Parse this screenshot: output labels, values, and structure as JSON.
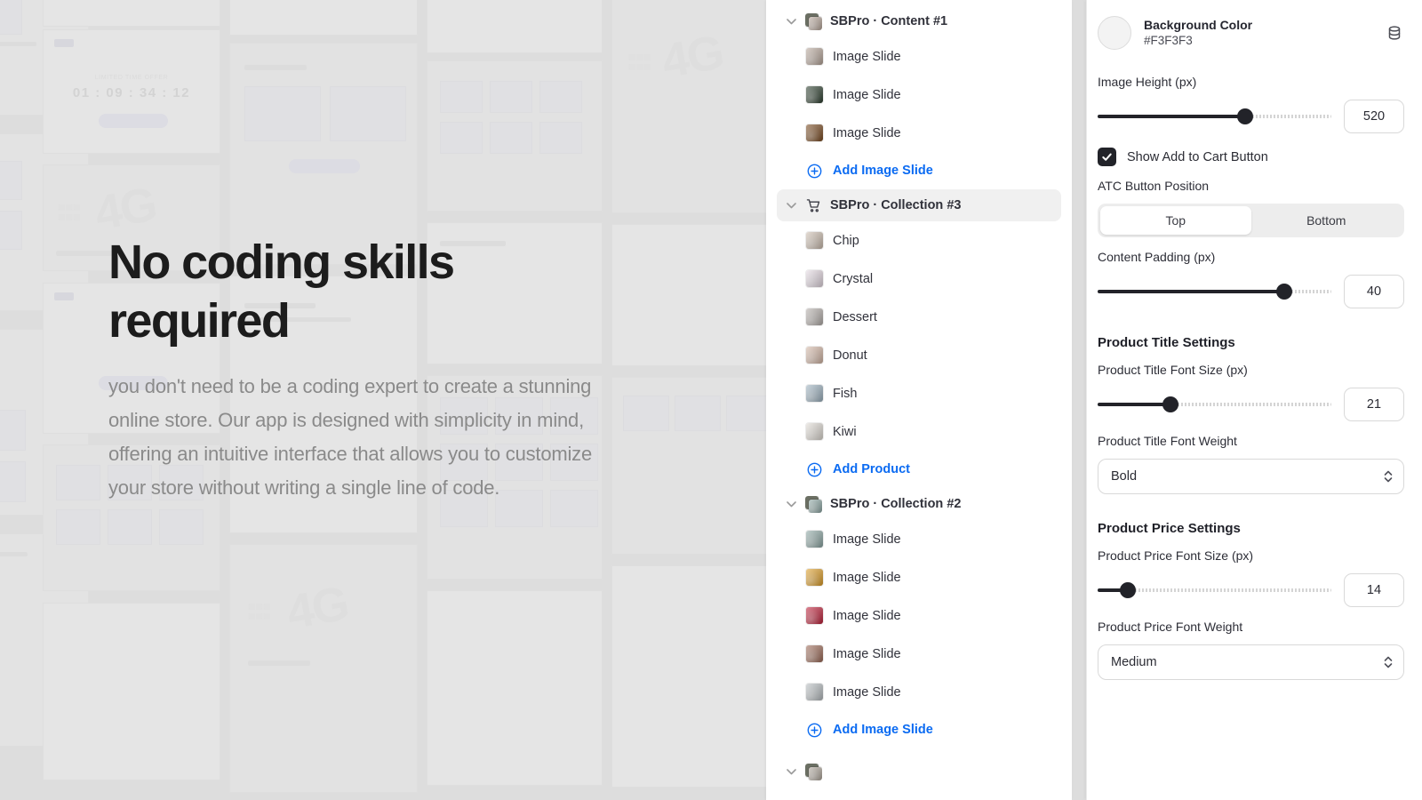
{
  "hero": {
    "title": "No coding skills\nrequired",
    "body": "you don't need to be a coding expert to create a stunning online store. Our app is designed with simplicity in mind, offering an intuitive interface that allows you to customize your store without writing a single line of code."
  },
  "background": {
    "timer_value": "01 : 09 : 34 : 12",
    "timer_label": "LIMITED TIME OFFER",
    "logo_text": "4G"
  },
  "tree": {
    "groups": [
      {
        "label": "SBPro · Content #1",
        "icon": "photo-stack-icon",
        "selected": false,
        "children": [
          {
            "label": "Image Slide",
            "thumb": "#b9a89c"
          },
          {
            "label": "Image Slide",
            "thumb": "#2e4030"
          },
          {
            "label": "Image Slide",
            "thumb": "#7a4a20"
          }
        ],
        "add_label": "Add Image Slide"
      },
      {
        "label": "SBPro · Collection #3",
        "icon": "shopping-cart-icon",
        "selected": true,
        "children": [
          {
            "label": "Chip",
            "thumb": "#cfc0b2"
          },
          {
            "label": "Crystal",
            "thumb": "#e6dbe4"
          },
          {
            "label": "Dessert",
            "thumb": "#b6b0ac"
          },
          {
            "label": "Donut",
            "thumb": "#d6b9a8"
          },
          {
            "label": "Fish",
            "thumb": "#9fb4c2"
          },
          {
            "label": "Kiwi",
            "thumb": "#e2ddd6"
          }
        ],
        "add_label": "Add Product"
      },
      {
        "label": "SBPro · Collection #2",
        "icon": "photo-stack-icon",
        "selected": false,
        "children": [
          {
            "label": "Image Slide",
            "thumb": "#8fa9a6"
          },
          {
            "label": "Image Slide",
            "thumb": "#e0a029"
          },
          {
            "label": "Image Slide",
            "thumb": "#c0213a"
          },
          {
            "label": "Image Slide",
            "thumb": "#9e6b58"
          },
          {
            "label": "Image Slide",
            "thumb": "#b9bfc2"
          }
        ],
        "add_label": "Add Image Slide"
      }
    ]
  },
  "settings": {
    "background_color": {
      "label": "Background Color",
      "value": "#F3F3F3",
      "swatch": "#F3F3F3"
    },
    "image_height": {
      "label": "Image Height (px)",
      "value": "520",
      "percent": 63
    },
    "show_add_to_cart": {
      "label": "Show Add to Cart Button",
      "checked": true
    },
    "atc_button_position": {
      "label": "ATC Button Position",
      "options": [
        "Top",
        "Bottom"
      ],
      "selected": "Top"
    },
    "content_padding": {
      "label": "Content Padding (px)",
      "value": "40",
      "percent": 80
    },
    "product_title_section": "Product Title Settings",
    "product_title_font_size": {
      "label": "Product Title Font Size (px)",
      "value": "21",
      "percent": 31
    },
    "product_title_font_weight": {
      "label": "Product Title Font Weight",
      "value": "Bold"
    },
    "product_price_section": "Product Price Settings",
    "product_price_font_size": {
      "label": "Product Price Font Size (px)",
      "value": "14",
      "percent": 13
    },
    "product_price_font_weight": {
      "label": "Product Price Font Weight",
      "value": "Medium"
    }
  }
}
